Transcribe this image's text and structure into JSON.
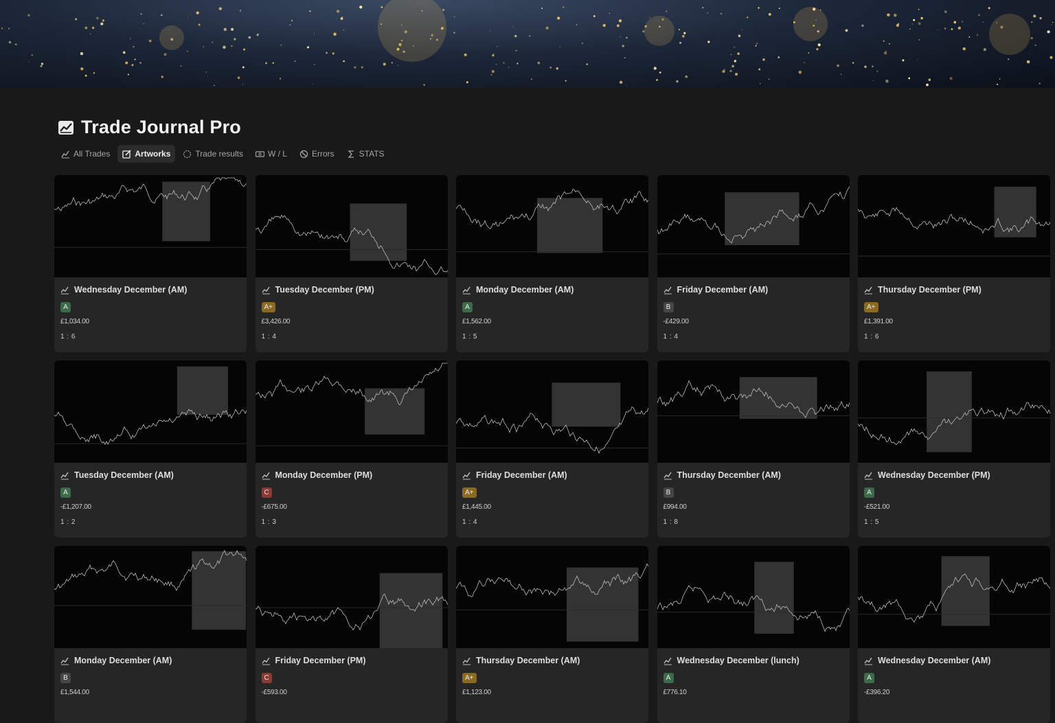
{
  "page": {
    "title": "Trade Journal Pro",
    "title_icon": "chart-line-icon"
  },
  "tabs": [
    {
      "label": "All Trades",
      "icon": "chart-icon",
      "active": false
    },
    {
      "label": "Artworks",
      "icon": "edit-icon",
      "active": true
    },
    {
      "label": "Trade results",
      "icon": "circle-dashed-icon",
      "active": false
    },
    {
      "label": "W / L",
      "icon": "money-icon",
      "active": false
    },
    {
      "label": "Errors",
      "icon": "prohibited-icon",
      "active": false
    },
    {
      "label": "STATS",
      "icon": "sigma-icon",
      "active": false
    }
  ],
  "grade_colors": {
    "A": "#3d6b4a",
    "A+": "#8a6a22",
    "B": "#464646",
    "C": "#8b3a34"
  },
  "cards": [
    {
      "title": "Wednesday December (AM)",
      "grade": "A",
      "pnl": "£1,034.00",
      "rr": "1 : 6"
    },
    {
      "title": "Tuesday December (PM)",
      "grade": "A+",
      "pnl": "£3,426.00",
      "rr": "1 : 4"
    },
    {
      "title": "Monday December (AM)",
      "grade": "A",
      "pnl": "£1,562.00",
      "rr": "1 : 5"
    },
    {
      "title": "Friday  December (AM)",
      "grade": "B",
      "pnl": "-£429.00",
      "rr": "1 : 4"
    },
    {
      "title": "Thursday  December (PM)",
      "grade": "A+",
      "pnl": "£1,391.00",
      "rr": "1 : 6"
    },
    {
      "title": "Tuesday  December (AM)",
      "grade": "A",
      "pnl": "-£1,207.00",
      "rr": "1 : 2"
    },
    {
      "title": "Monday December (PM)",
      "grade": "C",
      "pnl": "-£675.00",
      "rr": "1 : 3"
    },
    {
      "title": "Friday  December (AM)",
      "grade": "A+",
      "pnl": "£1,445.00",
      "rr": "1 : 4"
    },
    {
      "title": "Thursday  December (AM)",
      "grade": "B",
      "pnl": "£994.00",
      "rr": "1 : 8"
    },
    {
      "title": "Wednesday  December (PM)",
      "grade": "A",
      "pnl": "-£521.00",
      "rr": "1 : 5"
    },
    {
      "title": "Monday December (AM)",
      "grade": "B",
      "pnl": "£1,544.00",
      "rr": ""
    },
    {
      "title": "Friday December (PM)",
      "grade": "C",
      "pnl": "-£593.00",
      "rr": ""
    },
    {
      "title": "Thursday  December (AM)",
      "grade": "A+",
      "pnl": "£1,123.00",
      "rr": ""
    },
    {
      "title": "Wednesday  December (lunch)",
      "grade": "A",
      "pnl": "£776.10",
      "rr": ""
    },
    {
      "title": "Wednesday  December (AM)",
      "grade": "A",
      "pnl": "-£396.20",
      "rr": ""
    }
  ]
}
